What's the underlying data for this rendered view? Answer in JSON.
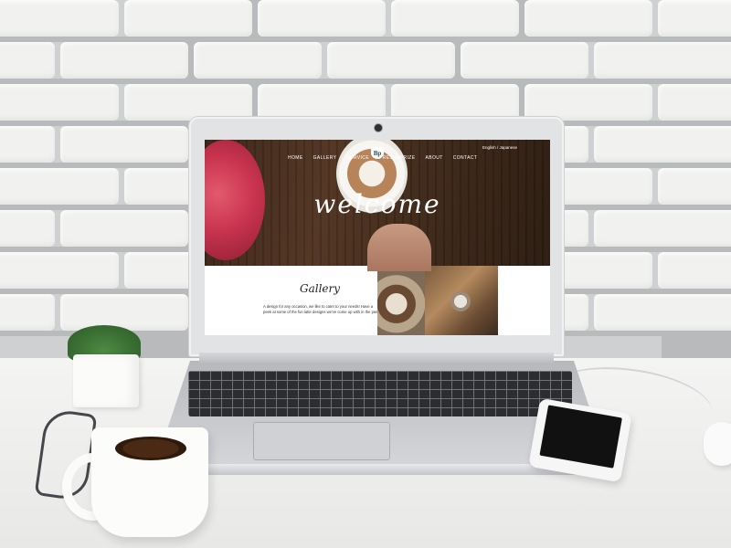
{
  "website": {
    "nav": [
      "HOME",
      "GALLERY",
      "SERVICE",
      "PRESS&PRIZE",
      "ABOUT",
      "CONTACT"
    ],
    "lang": "English / Japanese",
    "logo": "Bp",
    "welcome": "welcome",
    "gallery_title": "Gallery",
    "gallery_text": "A design for any occasion, we like to cater to your needs! Have a peek at some of the fun latte designs we've come up with in the past."
  },
  "colors": {
    "hero_brown": "#3a2518",
    "flower": "#c9344e",
    "wall": "#f1f1ef",
    "laptop": "#e2e3e5"
  },
  "icons": {
    "webcam": "webcam-icon",
    "logo": "cafe-logo-icon"
  }
}
